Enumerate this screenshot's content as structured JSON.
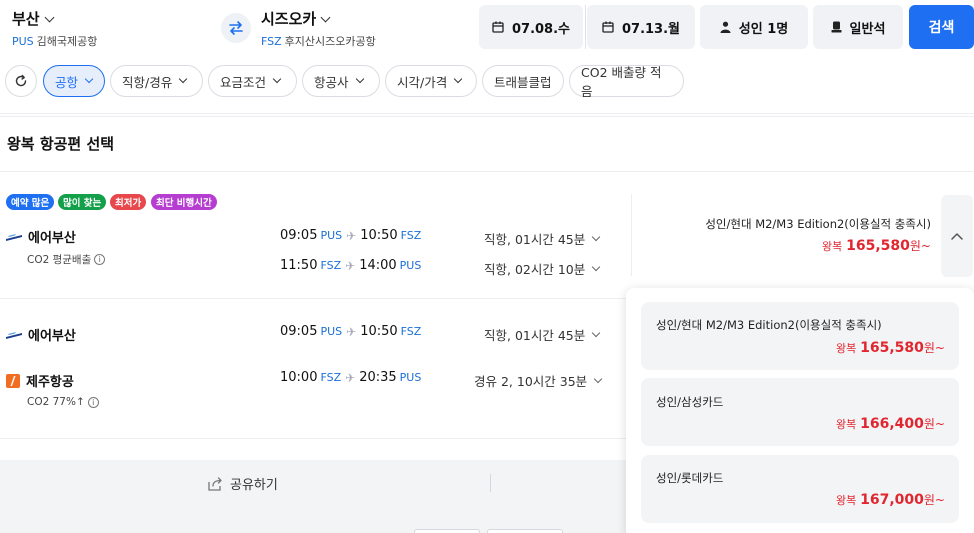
{
  "search": {
    "from_city": "부산",
    "from_code": "PUS",
    "from_airport": "김해국제공항",
    "to_city": "시즈오카",
    "to_code": "FSZ",
    "to_airport": "후지산시즈오카공항",
    "depart_date": "07.08.수",
    "return_date": "07.13.월",
    "passengers": "성인 1명",
    "cabin": "일반석",
    "search_label": "검색"
  },
  "filters": [
    "공항",
    "직항/경유",
    "요금조건",
    "항공사",
    "시각/가격",
    "트래블클럽",
    "CO2 배출량 적음"
  ],
  "section_title": "왕복 항공편 선택",
  "badges": [
    {
      "label": "예약 많은",
      "color": "#1e6ff1"
    },
    {
      "label": "많이 찾는",
      "color": "#14a04a"
    },
    {
      "label": "최저가",
      "color": "#e8474b"
    },
    {
      "label": "최단 비행시간",
      "color": "#b53ed0"
    }
  ],
  "result1": {
    "airline": "에어부산",
    "co2": "CO2 평균배출",
    "outbound": {
      "dep": "09:05",
      "dep_code": "PUS",
      "arr": "10:50",
      "arr_code": "FSZ",
      "duration": "직항, 01시간 45분"
    },
    "inbound": {
      "dep": "11:50",
      "dep_code": "FSZ",
      "arr": "14:00",
      "arr_code": "PUS",
      "duration": "직항, 02시간 10분"
    },
    "card_label": "성인/현대 M2/M3 Edition2(이용실적 충족시)",
    "price_prefix": "왕복",
    "price": "165,580",
    "price_suffix": "원~"
  },
  "result2": {
    "airline_out": "에어부산",
    "outbound": {
      "dep": "09:05",
      "dep_code": "PUS",
      "arr": "10:50",
      "arr_code": "FSZ",
      "duration": "직항, 01시간 45분"
    },
    "airline_in": "제주항공",
    "co2": "CO2 77%↑",
    "inbound": {
      "dep": "10:00",
      "dep_code": "FSZ",
      "arr": "20:35",
      "arr_code": "PUS",
      "duration": "경유 2, 10시간 35분"
    }
  },
  "dropdown": [
    {
      "label": "성인/현대 M2/M3 Edition2(이용실적 충족시)",
      "prefix": "왕복",
      "price": "165,580",
      "suffix": "원~"
    },
    {
      "label": "성인/삼성카드",
      "prefix": "왕복",
      "price": "166,400",
      "suffix": "원~"
    },
    {
      "label": "성인/롯데카드",
      "prefix": "왕복",
      "price": "167,000",
      "suffix": "원~"
    }
  ],
  "footer": {
    "share": "공유하기"
  }
}
